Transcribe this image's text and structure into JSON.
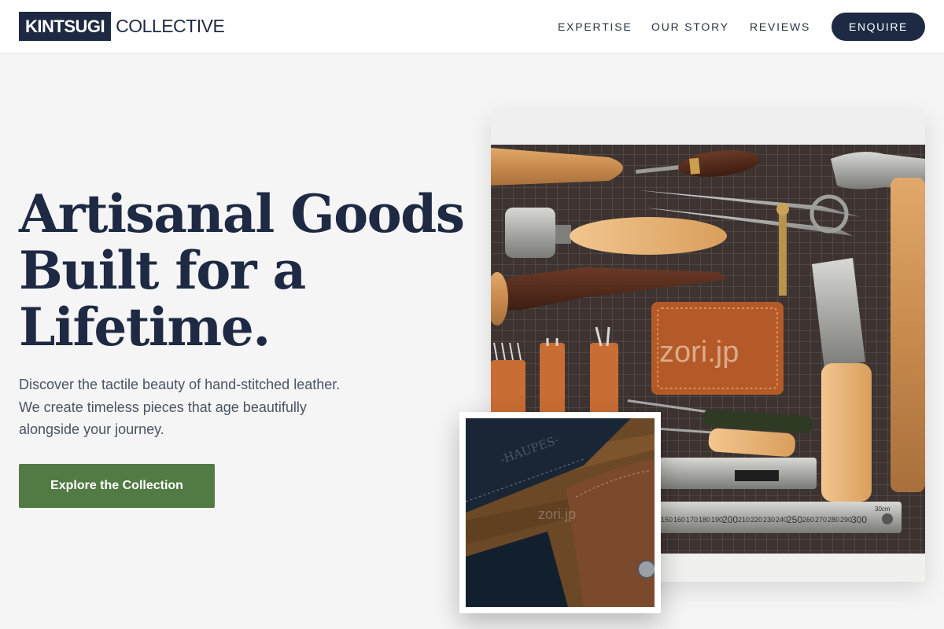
{
  "brand": {
    "logo_box": "KINTSUGI",
    "logo_text": "COLLECTIVE"
  },
  "nav": {
    "items": [
      {
        "label": "EXPERTISE"
      },
      {
        "label": "OUR STORY"
      },
      {
        "label": "REVIEWS"
      }
    ],
    "cta_label": "ENQUIRE"
  },
  "hero": {
    "headline_lines": [
      "Artisanal Goods",
      "Built for a",
      "Lifetime."
    ],
    "description_lines": [
      "Discover the tactile beauty of hand-stitched leather.",
      "We create timeless pieces that age beautifully",
      "alongside your journey."
    ],
    "cta_label": "Explore the Collection"
  },
  "images": {
    "main_watermark": "zori.jp",
    "inset_watermark": "zori.jp",
    "inset_emboss": "-HAUPES-",
    "ruler_labels": [
      "150",
      "160",
      "170",
      "180",
      "190",
      "200",
      "210",
      "220",
      "230",
      "240",
      "250",
      "260",
      "270",
      "280",
      "290",
      "300"
    ],
    "ruler_end": "30cm"
  },
  "colors": {
    "navy": "#1e2a44",
    "green": "#527a44",
    "background": "#f5f5f5"
  }
}
